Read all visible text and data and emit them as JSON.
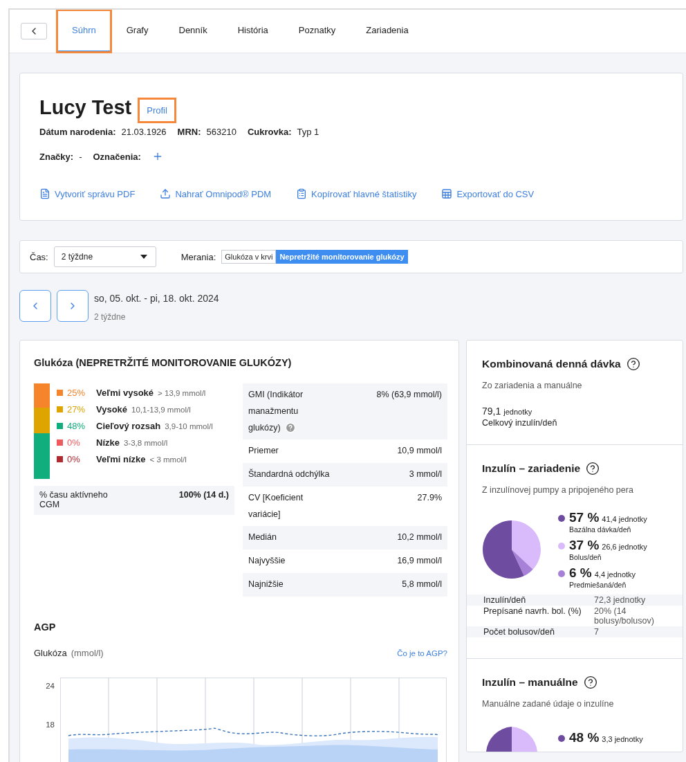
{
  "nav": {
    "tabs": [
      {
        "label": "Súhrn",
        "selected": true,
        "highlighted": true
      },
      {
        "label": "Grafy",
        "selected": false,
        "highlighted": false
      },
      {
        "label": "Denník",
        "selected": false,
        "highlighted": false
      },
      {
        "label": "História",
        "selected": false,
        "highlighted": false
      },
      {
        "label": "Poznatky",
        "selected": false,
        "highlighted": false
      },
      {
        "label": "Zariadenia",
        "selected": false,
        "highlighted": false
      }
    ]
  },
  "patient": {
    "name": "Lucy Test",
    "profile_link": {
      "label": "Profil",
      "highlighted": true
    },
    "fields": [
      {
        "label": "Dátum narodenia:",
        "value": "21.03.1926"
      },
      {
        "label": "MRN:",
        "value": "563210"
      },
      {
        "label": "Cukrovka:",
        "value": "Typ 1"
      }
    ],
    "tags": {
      "label": "Značky:",
      "value": "-"
    },
    "markers": {
      "label": "Označenia:"
    },
    "actions": [
      {
        "kind": "pdf",
        "label": "Vytvoriť správu PDF"
      },
      {
        "kind": "upload",
        "label": "Nahrať Omnipod® PDM"
      },
      {
        "kind": "copy",
        "label": "Kopírovať hlavné štatistiky"
      },
      {
        "kind": "export",
        "label": "Exportovať do CSV"
      }
    ]
  },
  "filters": {
    "time_label": "Čas:",
    "time_value": "2 týždne",
    "measurements_label": "Merania:",
    "measurements": [
      {
        "label": "Glukóza v krvi",
        "selected": false
      },
      {
        "label": "Nepretržité monitorovanie glukózy",
        "selected": true
      }
    ]
  },
  "date_range": {
    "range": "so, 05. okt. - pi, 18. okt. 2024",
    "period": "2 týždne"
  },
  "glucose": {
    "title": "Glukóza (NEPRETRŽITÉ MONITOROVANIE GLUKÓZY)",
    "bar_segments": [
      {
        "level": 0.25,
        "color": "#f5842b"
      },
      {
        "level": 0.27,
        "color": "#dea500"
      },
      {
        "level": 0.48,
        "color": "#0fae7c"
      }
    ],
    "ranges": [
      {
        "percent": "25%",
        "name": "Veľmi vysoké",
        "limits": "> 13,9 mmol/l",
        "color": "#f5842b"
      },
      {
        "percent": "27%",
        "name": "Vysoké",
        "limits": "10,1-13,9 mmol/l",
        "color": "#dea500"
      },
      {
        "percent": "48%",
        "name": "Cieľový rozsah",
        "limits": "3,9-10 mmol/l",
        "color": "#0fae7c"
      },
      {
        "percent": "0%",
        "name": "Nízke",
        "limits": "3-3,8 mmol/l",
        "color": "#ee5a5e"
      },
      {
        "percent": "0%",
        "name": "Veľmi nízke",
        "limits": "< 3 mmol/l",
        "color": "#b02a32"
      }
    ],
    "active_cgm": {
      "label": "% času aktívneho CGM",
      "value": "100% (14 d.)"
    },
    "stats": [
      {
        "label": "GMI (Indikátor manažmentu glukózy)",
        "value": "8% (63,9 mmol/l)",
        "help": true
      },
      {
        "label": "Priemer",
        "value": "10,9 mmol/l",
        "help": false
      },
      {
        "label": "Štandardná odchýlka",
        "value": "3 mmol/l",
        "help": false
      },
      {
        "label": "CV [Koeficient variácie]",
        "value": "27.9%",
        "help": false
      },
      {
        "label": "Medián",
        "value": "10,2 mmol/l",
        "help": false
      },
      {
        "label": "Najvyššie",
        "value": "16,9 mmol/l",
        "help": false
      },
      {
        "label": "Najnižšie",
        "value": "5,8 mmol/l",
        "help": false
      }
    ]
  },
  "agp": {
    "title": "AGP",
    "axis_label": "Glukóza",
    "unit": "(mmol/l)",
    "link": "Čo je to AGP?",
    "y_labels": [
      "24",
      "18"
    ]
  },
  "combined": {
    "title": "Kombinovaná denná dávka",
    "subtitle": "Zo zariadenia a manuálne",
    "value": "79,1",
    "unit": "jednotky",
    "caption": "Celkový inzulín/deň"
  },
  "device": {
    "title": "Inzulín – zariadenie",
    "subtitle": "Z inzulínovej pumpy a pripojeného pera",
    "chart_data": {
      "type": "pie",
      "values": [
        57,
        37,
        6
      ]
    },
    "legend": [
      {
        "percent": "57 %",
        "units": "41,4 jednotky",
        "caption": "Bazálna dávka/deň",
        "color": "#6e4c9f"
      },
      {
        "percent": "37 %",
        "units": "26,6 jednotky",
        "caption": "Bolus/deň",
        "color": "#d9bbfb"
      },
      {
        "percent": "6 %",
        "units": "4,4 jednotky",
        "caption": "Predmiešaná/deň",
        "color": "#a781d8"
      }
    ],
    "stats": [
      {
        "label": "Inzulín/deň",
        "value": "72,3 jednotky"
      },
      {
        "label": "Prepísané navrh. bol. (%)",
        "value": "20% (14 bolusy/bolusov)"
      },
      {
        "label": "Počet bolusov/deň",
        "value": "7"
      }
    ]
  },
  "manual": {
    "title": "Inzulín – manuálne",
    "subtitle": "Manuálne zadané údaje o inzulíne",
    "legend": [
      {
        "percent": "48 %",
        "units": "3,3 jednotky",
        "color": "#6e4c9f"
      }
    ]
  }
}
